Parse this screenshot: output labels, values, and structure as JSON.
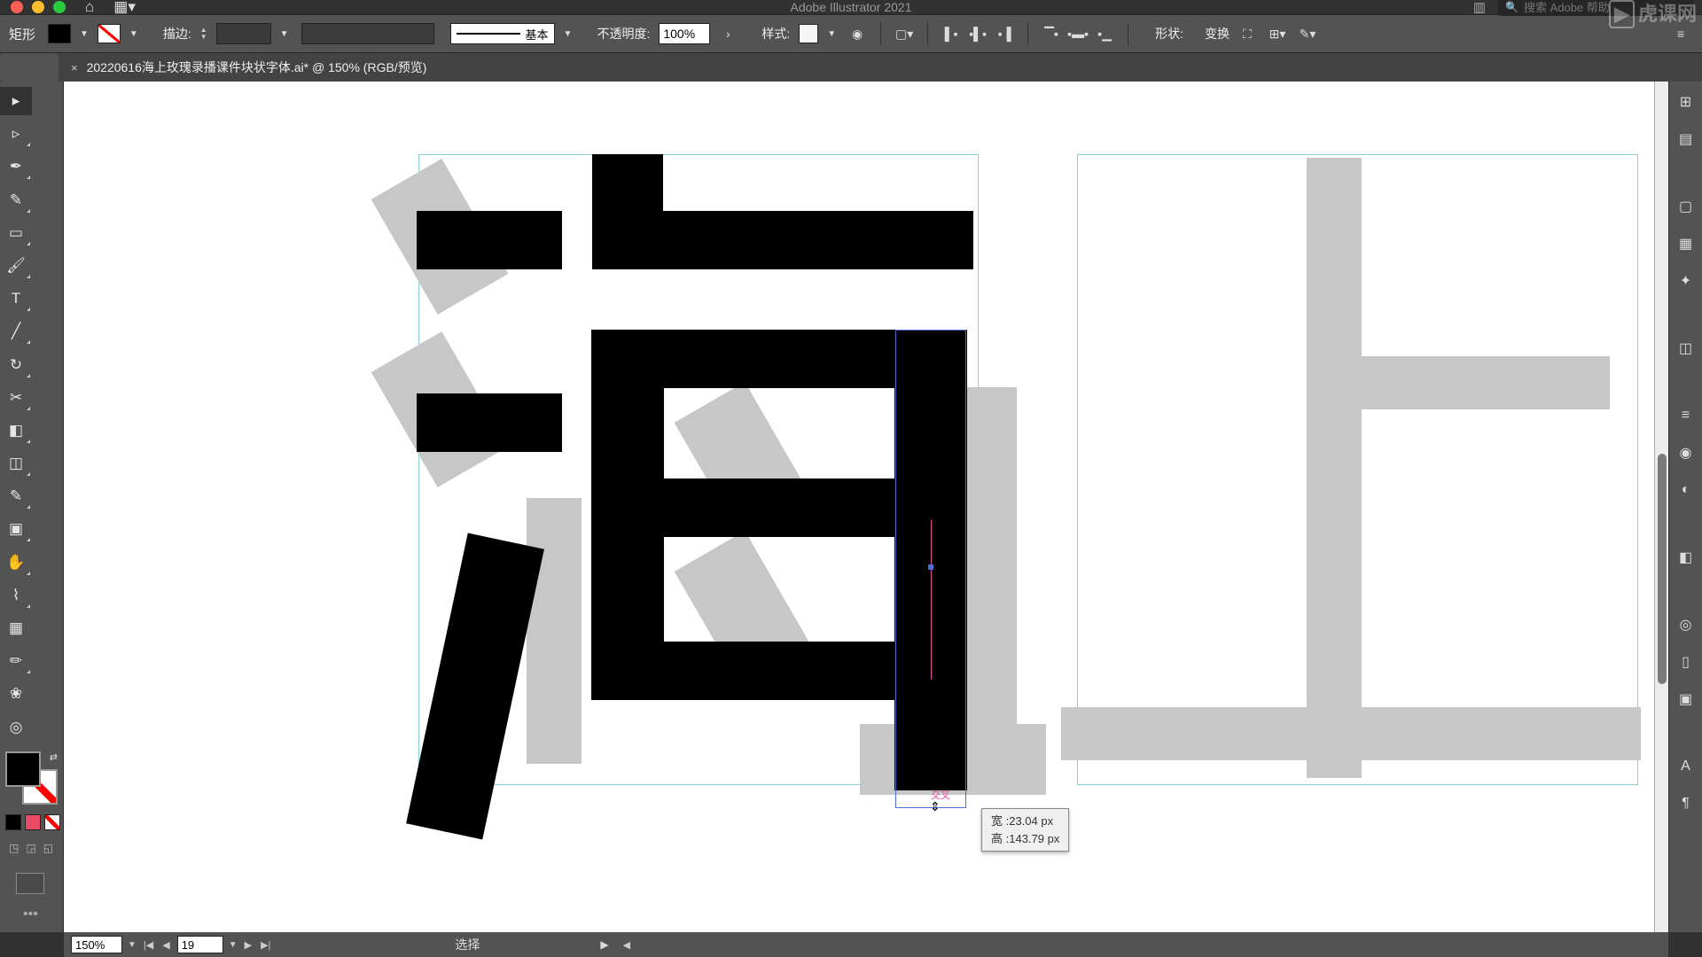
{
  "app": {
    "title": "Adobe Illustrator 2021"
  },
  "search": {
    "placeholder": "搜索 Adobe 帮助"
  },
  "watermark": {
    "text": "虎课网"
  },
  "document": {
    "tab": "20220616海上玫瑰录播课件块状字体.ai* @ 150% (RGB/预览)"
  },
  "controlbar": {
    "selection_label": "矩形",
    "stroke_label": "描边:",
    "line_style_label": "基本",
    "opacity_label": "不透明度:",
    "opacity_value": "100%",
    "style_label": "样式:",
    "shape_label": "形状:",
    "transform_label": "变换"
  },
  "tooltip": {
    "cross_label": "交叉",
    "width_label": "宽 ",
    "width_value": ":23.04 px",
    "height_label": "高 ",
    "height_value": ":143.79 px"
  },
  "status": {
    "zoom": "150%",
    "artboard": "19",
    "mode": "选择"
  }
}
